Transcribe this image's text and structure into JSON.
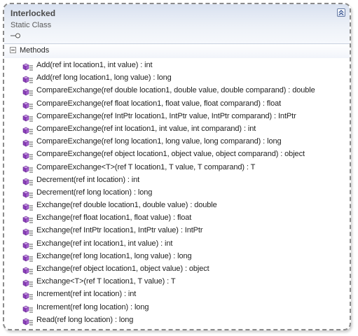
{
  "class_shape": {
    "title": "Interlocked",
    "subtitle": "Static Class",
    "collapse_icon": "double-chevron-up-icon",
    "interface_icon": "lollipop-icon"
  },
  "sections": [
    {
      "label": "Methods",
      "toggle": "minus",
      "method_icon": "method-icon",
      "items": [
        "Add(ref int location1, int value) : int",
        "Add(ref long location1, long value) : long",
        "CompareExchange(ref double location1, double value, double comparand) : double",
        "CompareExchange(ref float location1, float value, float comparand) : float",
        "CompareExchange(ref IntPtr location1, IntPtr value, IntPtr comparand) : IntPtr",
        "CompareExchange(ref int location1, int value, int comparand) : int",
        "CompareExchange(ref long location1, long value, long comparand) : long",
        "CompareExchange(ref object location1, object value, object comparand) : object",
        "CompareExchange<T>(ref T location1, T value, T comparand) : T",
        "Decrement(ref int location) : int",
        "Decrement(ref long location) : long",
        "Exchange(ref double location1, double value) : double",
        "Exchange(ref float location1, float value) : float",
        "Exchange(ref IntPtr location1, IntPtr value) : IntPtr",
        "Exchange(ref int location1, int value) : int",
        "Exchange(ref long location1, long value) : long",
        "Exchange(ref object location1, object value) : object",
        "Exchange<T>(ref T location1, T value) : T",
        "Increment(ref int location) : int",
        "Increment(ref long location) : long",
        "Read(ref long location) : long"
      ]
    }
  ],
  "colors": {
    "border": "#8a8a8a",
    "header_gradient_top": "#d9e1f0",
    "method_icon": "#8a3fb8"
  }
}
